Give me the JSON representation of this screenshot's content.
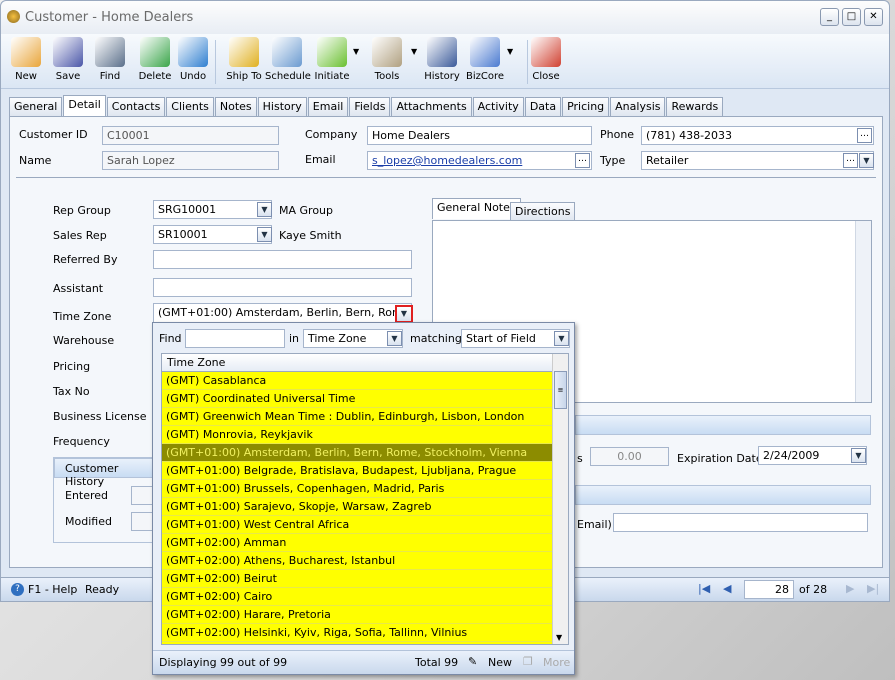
{
  "window": {
    "title": "Customer - Home Dealers",
    "controls": [
      "_",
      "□",
      "✕"
    ]
  },
  "toolbar": [
    {
      "label": "New",
      "color": "#e9a53a"
    },
    {
      "label": "Save",
      "color": "#4a56a8"
    },
    {
      "label": "Find",
      "color": "#5a6f8a"
    },
    {
      "label": "Delete",
      "color": "#3aa54a"
    },
    {
      "label": "Undo",
      "color": "#2f7fd0"
    },
    {
      "label": "Ship To",
      "color": "#e0b020"
    },
    {
      "label": "Schedule",
      "color": "#6a9ad0"
    },
    {
      "label": "Initiate",
      "color": "#6ac030"
    },
    {
      "label": "Tools",
      "color": "#b0a080"
    },
    {
      "label": "History",
      "color": "#3a5a9a"
    },
    {
      "label": "BizCore",
      "color": "#4a7ad0"
    },
    {
      "label": "Close",
      "color": "#d04030"
    }
  ],
  "tabs": [
    "General",
    "Detail",
    "Contacts",
    "Clients",
    "Notes",
    "History",
    "Email",
    "Fields",
    "Attachments",
    "Activity",
    "Data",
    "Pricing",
    "Analysis",
    "Rewards"
  ],
  "active_tab": "Detail",
  "header": {
    "customer_id_label": "Customer ID",
    "customer_id": "C10001",
    "name_label": "Name",
    "name": "Sarah Lopez",
    "company_label": "Company",
    "company": "Home Dealers",
    "email_label": "Email",
    "email": "s_lopez@homedealers.com",
    "phone_label": "Phone",
    "phone": "(781) 438-2033",
    "type_label": "Type",
    "type": "Retailer"
  },
  "detail": {
    "rep_group_label": "Rep Group",
    "rep_group": "SRG10001",
    "rep_group_name": "MA Group",
    "sales_rep_label": "Sales Rep",
    "sales_rep": "SR10001",
    "sales_rep_name": "Kaye Smith",
    "referred_by_label": "Referred By",
    "assistant_label": "Assistant",
    "time_zone_label": "Time Zone",
    "time_zone": "(GMT+01:00) Amsterdam, Berlin, Bern, Rome, Stockholm, Vienna",
    "warehouse_label": "Warehouse",
    "pricing_label": "Pricing",
    "tax_no_label": "Tax No",
    "business_license_label": "Business License",
    "frequency_label": "Frequency",
    "customer_history_label": "Customer History",
    "entered_label": "Entered",
    "modified_label": "Modified"
  },
  "notes_tabs": [
    "General Notes",
    "Directions"
  ],
  "right": {
    "amount_label_partial": "s",
    "amount": "0.00",
    "expiration_label": "Expiration Date",
    "expiration": "2/24/2009",
    "email_label_partial": "Email)"
  },
  "popup": {
    "find_label": "Find",
    "find_value": "",
    "in_label": "in",
    "in_value": "Time Zone",
    "matching_label": "matching",
    "matching_value": "Start of Field",
    "column": "Time Zone",
    "rows": [
      "(GMT) Casablanca",
      "(GMT) Coordinated Universal Time",
      "(GMT) Greenwich Mean Time : Dublin, Edinburgh, Lisbon, London",
      "(GMT) Monrovia, Reykjavik",
      "(GMT+01:00) Amsterdam, Berlin, Bern, Rome, Stockholm, Vienna",
      "(GMT+01:00) Belgrade, Bratislava, Budapest, Ljubljana, Prague",
      "(GMT+01:00) Brussels, Copenhagen, Madrid, Paris",
      "(GMT+01:00) Sarajevo, Skopje, Warsaw, Zagreb",
      "(GMT+01:00) West Central Africa",
      "(GMT+02:00) Amman",
      "(GMT+02:00) Athens, Bucharest, Istanbul",
      "(GMT+02:00) Beirut",
      "(GMT+02:00) Cairo",
      "(GMT+02:00) Harare, Pretoria",
      "(GMT+02:00) Helsinki, Kyiv, Riga, Sofia, Tallinn, Vilnius"
    ],
    "selected_index": 4,
    "status": "Displaying 99 out of 99",
    "total": "Total 99",
    "new_label": "New",
    "more_label": "More",
    "highlight_color": "#ffff00"
  },
  "statusbar": {
    "help": "F1 - Help",
    "status": "Ready",
    "page": "28",
    "of": "of 28"
  }
}
